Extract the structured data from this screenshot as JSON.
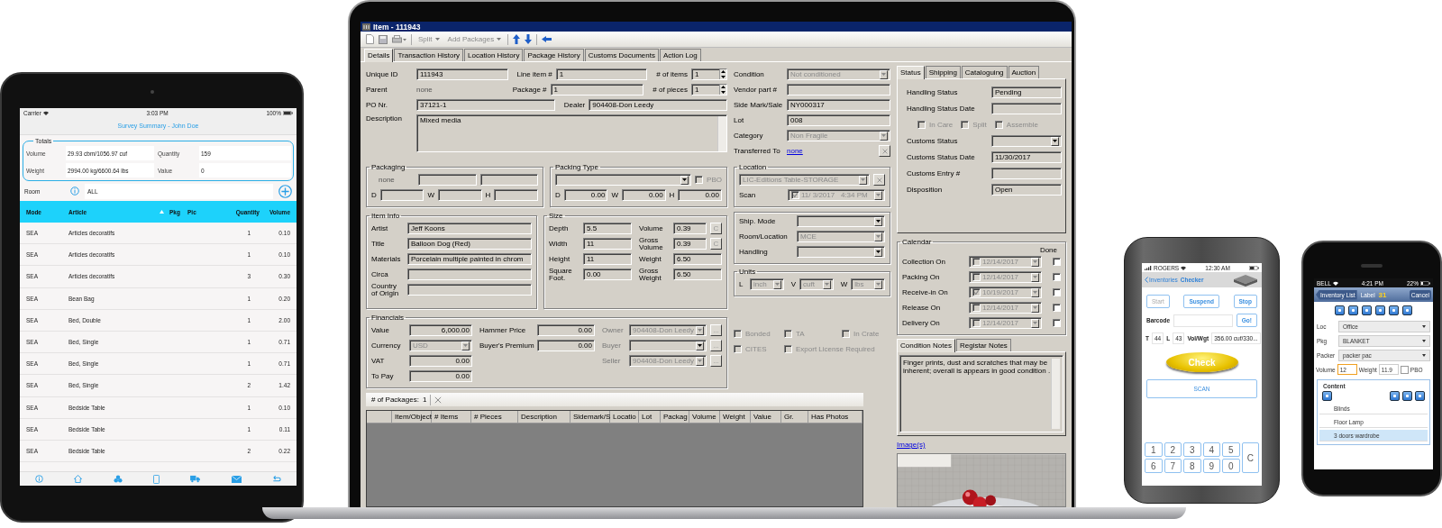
{
  "tablet": {
    "status_bar": {
      "carrier": "Carrier",
      "time": "3:03 PM",
      "battery": "100%"
    },
    "title": "Survey Summary - John Doe",
    "totals": {
      "legend": "Totals",
      "fields": [
        {
          "label": "Volume",
          "value": "29.93 cbm/1056.97 cuf"
        },
        {
          "label": "Quantity",
          "value": "159"
        },
        {
          "label": "Weight",
          "value": "2994.00 kg/6600.64 lbs"
        },
        {
          "label": "Value",
          "value": "0"
        }
      ]
    },
    "room": {
      "label": "Room",
      "value": "ALL"
    },
    "table": {
      "columns": [
        "Mode",
        "Article",
        "Pkg",
        "Pic",
        "Quantity",
        "Volume"
      ],
      "rows": [
        {
          "mode": "SEA",
          "article": "Articles decoratifs",
          "quantity": "1",
          "volume": "0.10"
        },
        {
          "mode": "SEA",
          "article": "Articles decoratifs",
          "quantity": "1",
          "volume": "0.10"
        },
        {
          "mode": "SEA",
          "article": "Articles decoratifs",
          "quantity": "3",
          "volume": "0.30"
        },
        {
          "mode": "SEA",
          "article": "Bean Bag",
          "quantity": "1",
          "volume": "0.20"
        },
        {
          "mode": "SEA",
          "article": "Bed, Double",
          "quantity": "1",
          "volume": "2.00"
        },
        {
          "mode": "SEA",
          "article": "Bed, Single",
          "quantity": "1",
          "volume": "0.71"
        },
        {
          "mode": "SEA",
          "article": "Bed, Single",
          "quantity": "1",
          "volume": "0.71"
        },
        {
          "mode": "SEA",
          "article": "Bed, Single",
          "quantity": "2",
          "volume": "1.42"
        },
        {
          "mode": "SEA",
          "article": "Bedside Table",
          "quantity": "1",
          "volume": "0.10"
        },
        {
          "mode": "SEA",
          "article": "Bedside Table",
          "quantity": "1",
          "volume": "0.11"
        },
        {
          "mode": "SEA",
          "article": "Bedside Table",
          "quantity": "2",
          "volume": "0.22"
        }
      ]
    }
  },
  "laptop": {
    "title": "Item - 111943",
    "toolbar": [
      {
        "label": "Split",
        "disabled": true
      },
      {
        "label": "Add Packages",
        "disabled": true
      }
    ],
    "tabs": [
      {
        "label": "Details",
        "selected": true
      },
      {
        "label": "Transaction History",
        "selected": false
      },
      {
        "label": "Location History",
        "selected": false
      },
      {
        "label": "Package History",
        "selected": false
      },
      {
        "label": "Customs Documents",
        "selected": false
      },
      {
        "label": "Action Log",
        "selected": false
      }
    ],
    "header": [
      [
        {
          "label": "Unique ID",
          "kind": "text",
          "value": "111943"
        },
        {
          "label": "Line item #",
          "kind": "text",
          "value": "1"
        },
        {
          "label": "# of items",
          "kind": "spin",
          "value": "1"
        }
      ],
      [
        {
          "label": "Parent",
          "kind": "static",
          "value": "none"
        },
        {
          "label": "Package #",
          "kind": "text",
          "value": "1"
        },
        {
          "label": "# of pieces",
          "kind": "spin",
          "value": "1"
        }
      ],
      [
        {
          "label": "PO Nr.",
          "kind": "text",
          "value": "37121-1"
        },
        {
          "label": "Dealer",
          "kind": "text",
          "value": "904408-Don Leedy"
        }
      ],
      [
        {
          "label": "Description",
          "kind": "area",
          "value": "Mixed media"
        }
      ]
    ],
    "side": [
      [
        {
          "label": "Condition",
          "kind": "combo",
          "value": "Not conditioned",
          "disabled": true
        }
      ],
      [
        {
          "label": "Vendor part #",
          "kind": "text"
        }
      ],
      [
        {
          "label": "Side Mark/Sale",
          "kind": "text",
          "value": "NY000317"
        }
      ],
      [
        {
          "label": "Lot",
          "kind": "text",
          "value": "008"
        }
      ],
      [
        {
          "label": "Category",
          "kind": "combo",
          "value": "Non Fragile",
          "disabled": true
        }
      ],
      [
        {
          "label": "Transferred To",
          "kind": "link",
          "value": "none"
        },
        {
          "kind": "xbutton"
        }
      ]
    ],
    "packaging": {
      "title": "Packaging",
      "columns": [
        [
          [
            {
              "kind": "static",
              "value": "none"
            },
            {
              "kind": "text"
            },
            {
              "kind": "text"
            }
          ],
          [
            {
              "label": "D",
              "kind": "text"
            },
            {
              "label": "W",
              "kind": "text"
            },
            {
              "label": "H",
              "kind": "text"
            }
          ]
        ]
      ]
    },
    "packing_type": {
      "title": "Packing Type",
      "columns": [
        [
          [
            {
              "kind": "combo",
              "disabled": false
            },
            {
              "kind": "check",
              "label": "PBO",
              "checked": false,
              "disabled": true
            }
          ],
          [
            {
              "label": "D",
              "kind": "num",
              "value": "0.00"
            },
            {
              "label": "W",
              "kind": "num",
              "value": "0.00"
            },
            {
              "label": "H",
              "kind": "num",
              "value": "0.00"
            }
          ]
        ]
      ]
    },
    "location": {
      "title": "Location",
      "columns": [
        [
          [
            {
              "kind": "combo",
              "value": "LIC-Editions Table-STORAGE",
              "disabled": true
            },
            {
              "kind": "xbutton"
            }
          ],
          [
            {
              "label": "Scan",
              "kind": "datecombo",
              "value": "11/ 3/2017   4:34 PM",
              "checked": true,
              "disabled": true
            }
          ]
        ]
      ]
    },
    "item_info": {
      "title": "Item Info",
      "columns": [
        [
          [
            {
              "label": "Artist",
              "kind": "text",
              "value": "Jeff Koons"
            }
          ],
          [
            {
              "label": "Title",
              "kind": "text",
              "value": "Balloon Dog (Red)"
            }
          ],
          [
            {
              "label": "Materials",
              "kind": "text",
              "value": "Porcelain multiple painted in chrom"
            }
          ],
          [
            {
              "label": "Circa",
              "kind": "text"
            }
          ],
          [
            {
              "label": "Country of Origin",
              "kind": "text"
            }
          ]
        ]
      ]
    },
    "size": {
      "title": "Size",
      "columns": [
        [
          [
            {
              "label": "Depth",
              "kind": "text",
              "value": "5.5"
            }
          ],
          [
            {
              "label": "Width",
              "kind": "text",
              "value": "11"
            }
          ],
          [
            {
              "label": "Height",
              "kind": "text",
              "value": "11"
            }
          ],
          [
            {
              "label": "Square Foot.",
              "kind": "text",
              "value": "0.00"
            }
          ]
        ],
        [
          [
            {
              "label": "Volume",
              "kind": "text",
              "value": "0.39"
            },
            {
              "kind": "button",
              "value": "C",
              "disabled": true
            }
          ],
          [
            {
              "label": "Gross Volume",
              "kind": "text",
              "value": "0.39"
            },
            {
              "kind": "button",
              "value": "C",
              "disabled": true
            }
          ],
          [
            {
              "label": "Weight",
              "kind": "text",
              "value": "6.50"
            }
          ],
          [
            {
              "label": "Gross Weight",
              "kind": "text",
              "value": "6.50"
            }
          ]
        ]
      ]
    },
    "shipping": {
      "columns": [
        [
          [
            {
              "label": "Ship. Mode",
              "kind": "combo",
              "disabled": false
            }
          ],
          [
            {
              "label": "Room/Location",
              "kind": "combo",
              "value": "MCE",
              "disabled": true
            }
          ],
          [
            {
              "label": "Handling",
              "kind": "combo",
              "disabled": false
            }
          ]
        ]
      ]
    },
    "units": {
      "title": "Units",
      "columns": [
        [
          [
            {
              "label": "L",
              "kind": "combo",
              "value": "inch",
              "disabled": true
            },
            {
              "label": "V",
              "kind": "combo",
              "value": "cuft",
              "disabled": true
            },
            {
              "label": "W",
              "kind": "combo",
              "value": "lbs",
              "disabled": true
            }
          ]
        ]
      ]
    },
    "financials": {
      "title": "Financials",
      "columns": [
        [
          [
            {
              "label": "Value",
              "kind": "num",
              "value": "6,000.00"
            }
          ],
          [
            {
              "label": "Currency",
              "kind": "combo",
              "value": "USD",
              "disabled": true
            }
          ],
          [
            {
              "label": "VAT",
              "kind": "num",
              "value": "0.00"
            }
          ],
          [
            {
              "label": "To Pay",
              "kind": "num",
              "value": "0.00"
            }
          ]
        ],
        [
          [
            {
              "label": "Hammer Price",
              "kind": "num",
              "value": "0.00"
            }
          ],
          [
            {
              "label": "Buyer's Premium",
              "kind": "num",
              "value": "0.00"
            }
          ]
        ],
        [
          [
            {
              "label": "Owner",
              "kind": "combo",
              "value": "904408-Don Leedy",
              "disabled": true
            },
            {
              "kind": "button",
              "value": "...",
              "disabled": true
            }
          ],
          [
            {
              "label": "Buyer",
              "kind": "combo",
              "disabled": false
            },
            {
              "kind": "button",
              "value": "...",
              "disabled": true
            }
          ],
          [
            {
              "label": "Seller",
              "kind": "combo",
              "value": "904408-Don Leedy",
              "disabled": true
            },
            {
              "kind": "button",
              "value": "...",
              "disabled": true
            }
          ]
        ]
      ]
    },
    "flags": [
      {
        "kind": "check",
        "label": "Bonded",
        "checked": false,
        "disabled": true
      },
      {
        "kind": "check",
        "label": "TA",
        "checked": false,
        "disabled": true
      },
      {
        "kind": "check",
        "label": "In Crate",
        "checked": false,
        "disabled": true
      },
      {
        "kind": "check",
        "label": "CITES",
        "checked": false,
        "disabled": true
      },
      {
        "kind": "check",
        "label": "Export License Required",
        "checked": false,
        "disabled": true
      }
    ],
    "packages": {
      "label": "# of Packages:",
      "count": "1",
      "columns": [
        "Item/Object",
        "# Items",
        "# Pieces",
        "Description",
        "Sidemark/S",
        "Locatio",
        "Lot",
        "Packag",
        "Volume",
        "Weight",
        "Value",
        "Gr.",
        "Has Photos"
      ]
    },
    "status_tabs": [
      {
        "label": "Status",
        "selected": true
      },
      {
        "label": "Shipping",
        "selected": false
      },
      {
        "label": "Cataloguing",
        "selected": false
      },
      {
        "label": "Auction",
        "selected": false
      }
    ],
    "status": [
      [
        {
          "label": "Handling Status",
          "kind": "text",
          "value": "Pending"
        }
      ],
      [
        {
          "label": "Handling Status Date",
          "kind": "text"
        }
      ],
      [
        {
          "kind": "check",
          "label": "In Care",
          "checked": false,
          "disabled": true
        },
        {
          "kind": "check",
          "label": "Split",
          "checked": false,
          "disabled": true
        },
        {
          "kind": "check",
          "label": "Assemble",
          "checked": false,
          "disabled": true
        }
      ],
      [
        {
          "label": "Customs Status",
          "kind": "combo",
          "disabled": false
        }
      ],
      [
        {
          "label": "Customs Status Date",
          "kind": "text",
          "value": "11/30/2017"
        }
      ],
      [
        {
          "label": "Customs Entry #",
          "kind": "text"
        }
      ],
      [
        {
          "label": "Disposition",
          "kind": "text",
          "value": "Open"
        }
      ]
    ],
    "calendar": {
      "title": "Calendar",
      "done": "Done",
      "rows": [
        [
          {
            "label": "Collection On",
            "kind": "datecombo",
            "value": "12/14/2017",
            "checked": false,
            "disabled": true
          },
          {
            "kind": "check",
            "checked": false,
            "disabled": false
          }
        ],
        [
          {
            "label": "Packing On",
            "kind": "datecombo",
            "value": "12/14/2017",
            "checked": false,
            "disabled": true
          },
          {
            "kind": "check",
            "checked": false,
            "disabled": false
          }
        ],
        [
          {
            "label": "Receive-in On",
            "kind": "datecombo",
            "value": "10/19/2017",
            "checked": true,
            "disabled": true
          },
          {
            "kind": "check",
            "checked": false,
            "disabled": false
          }
        ],
        [
          {
            "label": "Release On",
            "kind": "datecombo",
            "value": "12/14/2017",
            "checked": false,
            "disabled": true
          },
          {
            "kind": "check",
            "checked": false,
            "disabled": false
          }
        ],
        [
          {
            "label": "Delivery On",
            "kind": "datecombo",
            "value": "12/14/2017",
            "checked": false,
            "disabled": true
          },
          {
            "kind": "check",
            "checked": false,
            "disabled": false
          }
        ]
      ]
    },
    "notes_tabs": [
      {
        "label": "Condition Notes",
        "selected": true
      },
      {
        "label": "Registar Notes",
        "selected": false
      }
    ],
    "notes": "Finger prints, dust and scratches that may be inherent; overall is appears in good condition .",
    "images_link": "Image(s)",
    "photo": {
      "kind": "picture"
    }
  },
  "checker_phone": {
    "status_bar": {
      "carrier": "ROGERS",
      "time": "12:30 AM"
    },
    "nav": {
      "back": "Inventories",
      "title": "Checker"
    },
    "actions": [
      {
        "label": "Start",
        "disabled": true
      },
      {
        "label": "Suspend",
        "disabled": false
      },
      {
        "label": "Stop",
        "disabled": false
      }
    ],
    "barcode": {
      "label": "Barcode",
      "button": "Go!"
    },
    "counts": [
      {
        "label": "T",
        "value": "44"
      },
      {
        "label": "L",
        "value": "43"
      },
      {
        "label": "Vol/Wgt",
        "value": "356.00 cuf/330..."
      }
    ],
    "check_button": "Check",
    "scan_button": "SCAN",
    "keypad": [
      "1",
      "2",
      "3",
      "4",
      "5",
      "6",
      "7",
      "8",
      "9",
      "0",
      "C"
    ]
  },
  "label_phone": {
    "status_bar": {
      "carrier": "BELL",
      "time": "4:21 PM",
      "battery": "22%"
    },
    "nav": {
      "back": "Inventory List",
      "title": "Label",
      "number": "31",
      "cancel": "Cancel"
    },
    "fields": [
      {
        "label": "Loc",
        "value": "Office"
      },
      {
        "label": "Pkg",
        "value": "BLANKET"
      },
      {
        "label": "Packer",
        "value": "packer pac"
      }
    ],
    "volume": {
      "label": "Volume",
      "value": "12",
      "focused": true
    },
    "weight": {
      "label": "Weight",
      "value": "11.9"
    },
    "pbo": {
      "label": "PBO",
      "checked": false
    },
    "content": {
      "label": "Content",
      "items": [
        {
          "label": "Blinds",
          "selected": false
        },
        {
          "label": "Floor Lamp",
          "selected": false
        },
        {
          "label": "3 doors wardrobe",
          "selected": true
        }
      ]
    }
  }
}
